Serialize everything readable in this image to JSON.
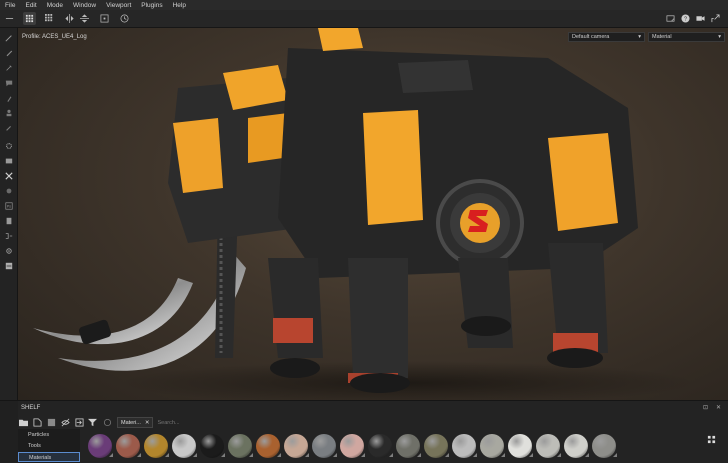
{
  "menu": [
    "File",
    "Edit",
    "Mode",
    "Window",
    "Viewport",
    "Plugins",
    "Help"
  ],
  "viewport": {
    "profile_label": "Profile: ACES_UE4_Log",
    "camera_select": "Default camera",
    "channel_select": "Material"
  },
  "shelf": {
    "title": "SHELF",
    "categories": [
      "Particles",
      "Tools",
      "Materials"
    ],
    "selected_category": "Materials",
    "filter_chip": "Materi...",
    "search_placeholder": "Search...",
    "materials": [
      {
        "icon": "material-purple",
        "color": "#6a3c78"
      },
      {
        "icon": "material-rust",
        "color": "#9c5a4a"
      },
      {
        "icon": "material-gold",
        "color": "#b3862c"
      },
      {
        "icon": "material-chrome",
        "color": "#c9c9c9"
      },
      {
        "icon": "material-black",
        "color": "#1b1b1b"
      },
      {
        "icon": "material-moss",
        "color": "#6b7260"
      },
      {
        "icon": "material-leaf",
        "color": "#a9612f"
      },
      {
        "icon": "material-skin",
        "color": "#c6a795"
      },
      {
        "icon": "material-stone",
        "color": "#7a7e82"
      },
      {
        "icon": "material-pink",
        "color": "#d0a7a0"
      },
      {
        "icon": "material-gloss-black",
        "color": "#2a2a2a"
      },
      {
        "icon": "material-concrete",
        "color": "#6f7068"
      },
      {
        "icon": "material-olive",
        "color": "#77745a"
      },
      {
        "icon": "material-silver",
        "color": "#bcbcbc"
      },
      {
        "icon": "material-marble",
        "color": "#a8a8a0"
      },
      {
        "icon": "material-white",
        "color": "#e0e0dc"
      },
      {
        "icon": "material-light-grey",
        "color": "#bdbdb8"
      },
      {
        "icon": "material-plaster",
        "color": "#cfcfca"
      },
      {
        "icon": "material-ash",
        "color": "#8e8e8a"
      }
    ]
  }
}
